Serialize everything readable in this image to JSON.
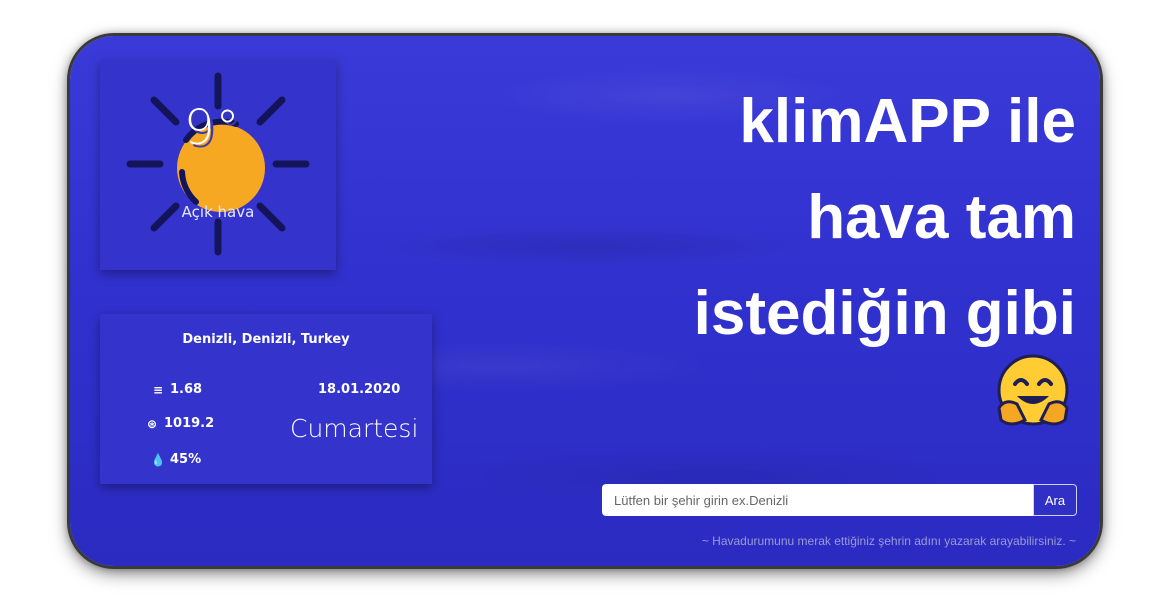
{
  "weather": {
    "temperature": "9°",
    "condition": "Açık hava",
    "icon": "sun-icon"
  },
  "details": {
    "location": "Denizli, Denizli, Turkey",
    "wind": "1.68",
    "pressure": "1019.2",
    "humidity": "45%",
    "date": "18.01.2020",
    "day": "Cumartesi"
  },
  "hero": {
    "line1": "klimAPP ile",
    "line2": "hava tam",
    "line3": "istediğin gibi",
    "emoji": "hugging-face-emoji"
  },
  "search": {
    "placeholder": "Lütfen bir şehir girin ex.Denizli",
    "button_label": "Ara",
    "hint": "~ Havadurumunu merak ettiğiniz şehrin adını yazarak arayabilirsiniz. ~"
  },
  "colors": {
    "background": "#3131cf",
    "card": "#3434cc",
    "sun": "#f7a823",
    "sun_rays": "#14145a"
  }
}
